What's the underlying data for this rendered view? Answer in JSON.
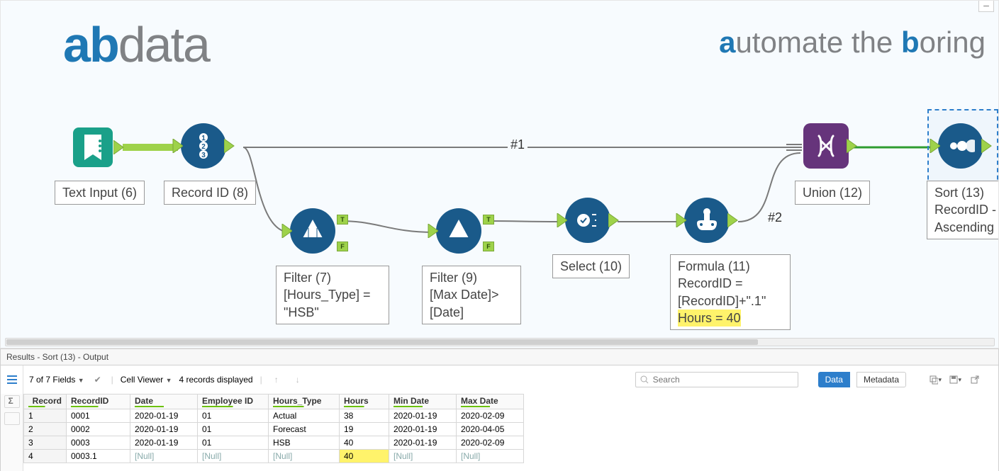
{
  "brand": {
    "ab_a": "a",
    "ab_b": "b",
    "ab_data": "data",
    "tag_prefix": "utomate the ",
    "tag_a": "a",
    "tag_b": "b",
    "tag_suffix": "oring"
  },
  "expand_btn": "–",
  "nodes": {
    "text_input": "Text Input (6)",
    "record_id": "Record ID (8)",
    "filter1_l1": "Filter (7)",
    "filter1_l2": "[Hours_Type] =",
    "filter1_l3": "\"HSB\"",
    "filter2_l1": "Filter (9)",
    "filter2_l2": "[Max Date]>",
    "filter2_l3": "[Date]",
    "select": "Select (10)",
    "formula_l1": "Formula (11)",
    "formula_l2": "RecordID =",
    "formula_l3": "[RecordID]+\".1\"",
    "formula_l4": "Hours = 40",
    "union": "Union (12)",
    "sort_l1": "Sort (13)",
    "sort_l2": "RecordID -",
    "sort_l3": "Ascending"
  },
  "tf_labels": {
    "T": "T",
    "F": "F"
  },
  "connector_labels": {
    "r1": "#1",
    "r2": "#2"
  },
  "results_header": "Results - Sort (13) - Output",
  "toolbar": {
    "fields_label": "7 of 7 Fields",
    "cell_viewer": "Cell Viewer",
    "records_displayed": "4 records displayed",
    "search_placeholder": "Search",
    "data_btn": "Data",
    "metadata_btn": "Metadata"
  },
  "table": {
    "headers": [
      "Record",
      "RecordID",
      "Date",
      "Employee ID",
      "Hours_Type",
      "Hours",
      "Min Date",
      "Max Date"
    ],
    "rows": [
      {
        "n": "1",
        "cells": [
          "0001",
          "2020-01-19",
          "01",
          "Actual",
          "38",
          "2020-01-19",
          "2020-02-09"
        ],
        "null": [
          false,
          false,
          false,
          false,
          false,
          false,
          false
        ]
      },
      {
        "n": "2",
        "cells": [
          "0002",
          "2020-01-19",
          "01",
          "Forecast",
          "19",
          "2020-01-19",
          "2020-04-05"
        ],
        "null": [
          false,
          false,
          false,
          false,
          false,
          false,
          false
        ]
      },
      {
        "n": "3",
        "cells": [
          "0003",
          "2020-01-19",
          "01",
          "HSB",
          "40",
          "2020-01-19",
          "2020-02-09"
        ],
        "null": [
          false,
          false,
          false,
          false,
          false,
          false,
          false
        ]
      },
      {
        "n": "4",
        "cells": [
          "0003.1",
          "[Null]",
          "[Null]",
          "[Null]",
          "40",
          "[Null]",
          "[Null]"
        ],
        "null": [
          false,
          true,
          true,
          true,
          false,
          true,
          true
        ],
        "hl": 4
      }
    ]
  },
  "colors": {
    "node_fill": "#1a5a8a",
    "union_fill": "#66347b",
    "textinput_fill": "#1aa089",
    "sel_stroke": "#2d7ecb"
  }
}
